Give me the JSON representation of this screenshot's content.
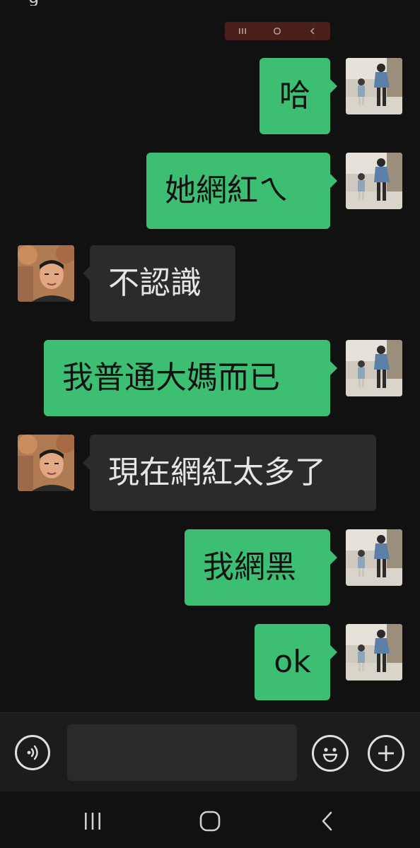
{
  "header": {
    "title_fragment": "g"
  },
  "mini_nav": {
    "recent_glyph": "|||",
    "home_glyph": "O",
    "back_glyph": "<"
  },
  "messages": [
    {
      "sender": "me",
      "text": "哈"
    },
    {
      "sender": "me",
      "text": "她網紅ㄟ"
    },
    {
      "sender": "other",
      "text": "不認識"
    },
    {
      "sender": "me",
      "text": "我普通大媽而已"
    },
    {
      "sender": "other",
      "text": "現在網紅太多了"
    },
    {
      "sender": "me",
      "text": "我網黑"
    },
    {
      "sender": "me",
      "text": "ok"
    }
  ],
  "input": {
    "value": "",
    "placeholder": ""
  },
  "icons": {
    "voice": "voice-icon",
    "emoji": "emoji-icon",
    "add": "plus-icon"
  },
  "colors": {
    "my_bubble": "#3dbf73",
    "their_bubble": "#2b2b2b",
    "background": "#111111"
  }
}
